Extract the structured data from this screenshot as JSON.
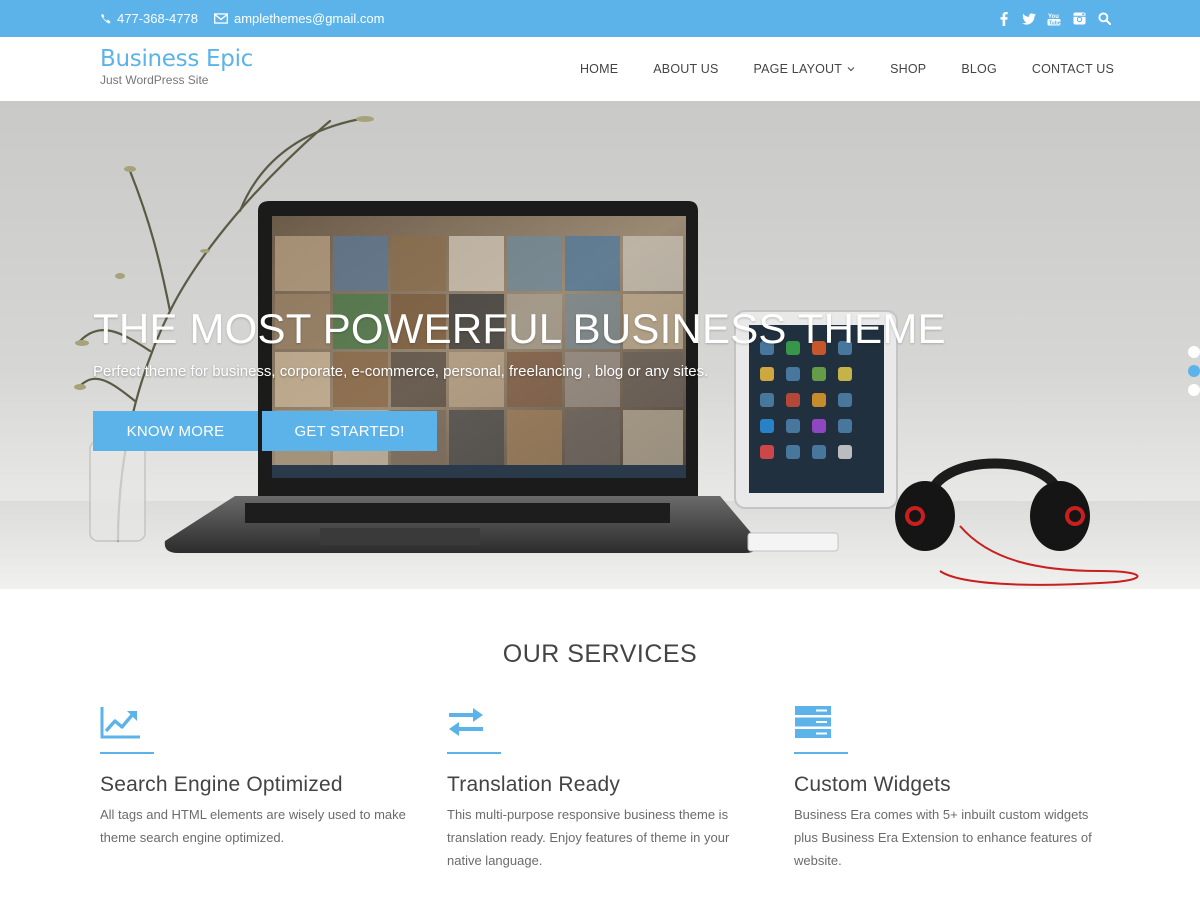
{
  "topbar": {
    "phone": "477-368-4778",
    "email": "amplethemes@gmail.com",
    "social_icons": [
      "facebook-icon",
      "twitter-icon",
      "youtube-icon",
      "instagram-icon",
      "search-icon"
    ]
  },
  "header": {
    "site_title": "Business Epic",
    "tagline": "Just WordPress Site",
    "nav": [
      "HOME",
      "ABOUT US",
      "PAGE LAYOUT",
      "SHOP",
      "BLOG",
      "CONTACT US"
    ]
  },
  "hero": {
    "title": "THE MOST POWERFUL BUSINESS THEME",
    "subtitle": "Perfect theme for business, corporate, e-commerce, personal, freelancing , blog or any sites.",
    "button_primary": "KNOW MORE",
    "button_secondary": "GET STARTED!",
    "slide_count": 3,
    "active_slide": 2
  },
  "services": {
    "heading": "OUR SERVICES",
    "items": [
      {
        "icon": "line-chart-icon",
        "title": "Search Engine Optimized",
        "description": "All tags and HTML elements are wisely used to make theme search engine optimized."
      },
      {
        "icon": "exchange-arrows-icon",
        "title": "Translation Ready",
        "description": "This multi-purpose responsive business theme is translation ready. Enjoy features of theme in your native language."
      },
      {
        "icon": "server-icon",
        "title": "Custom Widgets",
        "description": "Business Era comes with 5+ inbuilt custom widgets plus Business Era Extension to enhance features of website."
      }
    ]
  },
  "colors": {
    "accent": "#5cb3ea",
    "text": "#444444"
  }
}
